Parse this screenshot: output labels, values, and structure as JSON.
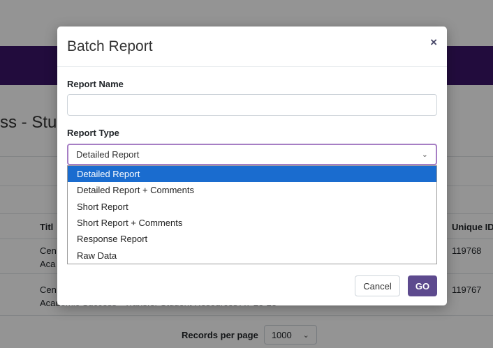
{
  "background": {
    "page_title": "ss - Stu",
    "table": {
      "col_title": "Titl",
      "col_unique_id": "Unique ID",
      "rows": [
        {
          "title_line1": "Cen",
          "title_line2": "Aca",
          "unique_id": "119768"
        },
        {
          "title_line1": "Cen",
          "title_line2": "Academic Success - Transfer Student Resources AY 23-23",
          "unique_id": "119767"
        }
      ]
    },
    "footer": {
      "records_label": "Records per page",
      "records_value": "1000"
    }
  },
  "modal": {
    "title": "Batch Report",
    "close_glyph": "×",
    "report_name_label": "Report Name",
    "report_name_value": "",
    "report_name_placeholder": "",
    "report_type_label": "Report Type",
    "report_type_selected": "Detailed Report",
    "report_type_options": [
      "Detailed Report",
      "Detailed Report + Comments",
      "Short Report",
      "Short Report + Comments",
      "Response Report",
      "Raw Data"
    ],
    "cancel_label": "Cancel",
    "go_label": "GO"
  },
  "colors": {
    "header_purple": "#3b1669",
    "select_focus_border": "#a67ec4",
    "option_highlight": "#1a6ccf",
    "go_button": "#5d4a8e"
  }
}
